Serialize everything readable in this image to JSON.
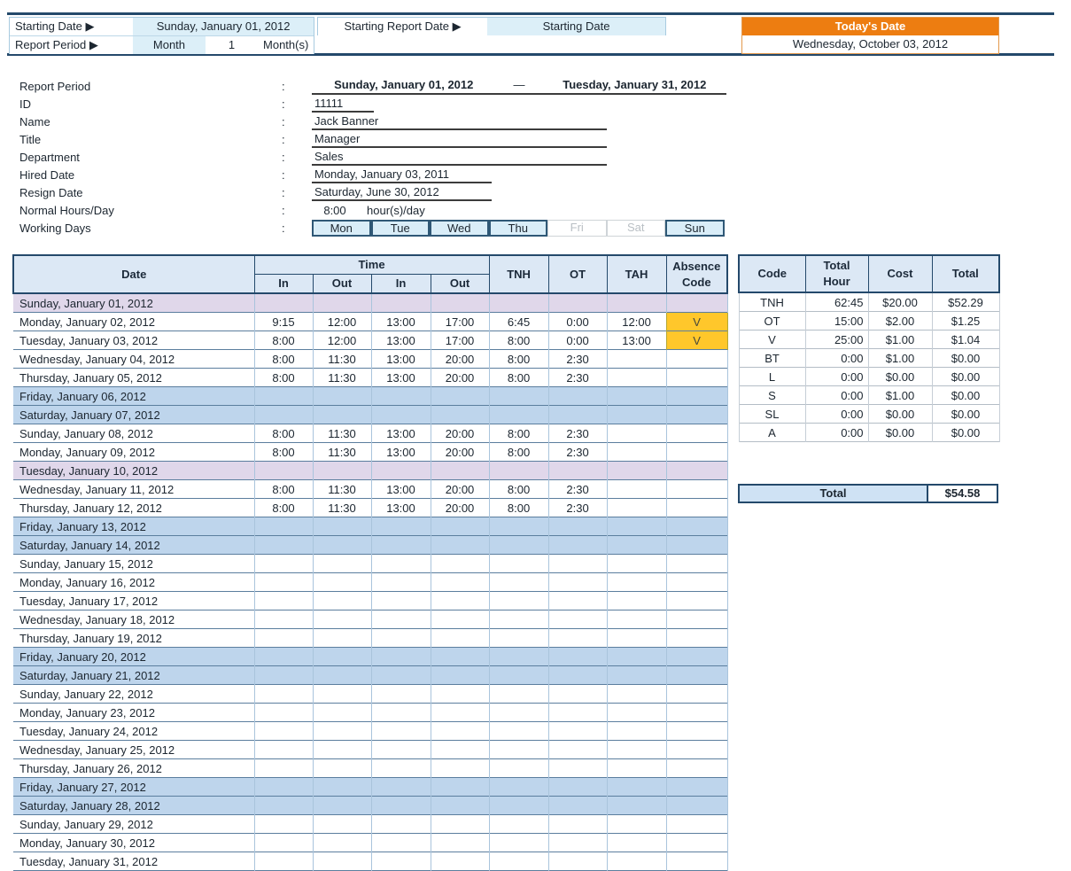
{
  "colors": {
    "navy": "#24496B",
    "orange": "#ED7D11",
    "header_blue": "#DCE8F5",
    "topbar_blue": "#DCEFF8",
    "weekend_blue": "#BED5EC",
    "holiday_purple": "#E0D7EA",
    "absence_gold": "#FFC72B"
  },
  "topbar": {
    "starting_date_label": "Starting Date ▶",
    "starting_date_value": "Sunday, January 01, 2012",
    "report_period_label": "Report Period ▶",
    "month_label": "Month",
    "month_value": "1",
    "months_label": "Month(s)",
    "starting_report_date_label": "Starting Report Date ▶",
    "starting_report_date_value": "Starting Date",
    "todays_date_label": "Today's Date",
    "todays_date_value": "Wednesday, October 03, 2012"
  },
  "info": {
    "colon": ":",
    "report_period": {
      "label": "Report Period",
      "from": "Sunday, January 01, 2012",
      "dash": "—",
      "to": "Tuesday, January 31, 2012"
    },
    "id": {
      "label": "ID",
      "value": "11111"
    },
    "name": {
      "label": "Name",
      "value": "Jack Banner"
    },
    "title": {
      "label": "Title",
      "value": "Manager"
    },
    "department": {
      "label": "Department",
      "value": "Sales"
    },
    "hired_date": {
      "label": "Hired Date",
      "value": "Monday, January 03, 2011"
    },
    "resign_date": {
      "label": "Resign Date",
      "value": "Saturday, June 30, 2012"
    },
    "normal_hours": {
      "label": "Normal Hours/Day",
      "value": "8:00",
      "suffix": "hour(s)/day"
    },
    "working_days_label": "Working Days",
    "working_days": [
      {
        "name": "Mon",
        "active": true
      },
      {
        "name": "Tue",
        "active": true
      },
      {
        "name": "Wed",
        "active": true
      },
      {
        "name": "Thu",
        "active": true
      },
      {
        "name": "Fri",
        "active": false
      },
      {
        "name": "Sat",
        "active": false
      },
      {
        "name": "Sun",
        "active": true
      }
    ]
  },
  "timesheet": {
    "header": {
      "date": "Date",
      "time": "Time",
      "in1": "In",
      "out1": "Out",
      "in2": "In",
      "out2": "Out",
      "tnh": "TNH",
      "ot": "OT",
      "tah": "TAH",
      "absence": "Absence\nCode"
    },
    "rows": [
      {
        "date": "Sunday, January 01, 2012",
        "type": "holiday",
        "cells": [
          "",
          "",
          "",
          "",
          "",
          "",
          ""
        ],
        "absence": ""
      },
      {
        "date": "Monday, January 02, 2012",
        "type": "normal",
        "cells": [
          "9:15",
          "12:00",
          "13:00",
          "17:00",
          "6:45",
          "0:00",
          "12:00"
        ],
        "absence": "V"
      },
      {
        "date": "Tuesday, January 03, 2012",
        "type": "normal",
        "cells": [
          "8:00",
          "12:00",
          "13:00",
          "17:00",
          "8:00",
          "0:00",
          "13:00"
        ],
        "absence": "V"
      },
      {
        "date": "Wednesday, January 04, 2012",
        "type": "normal",
        "cells": [
          "8:00",
          "11:30",
          "13:00",
          "20:00",
          "8:00",
          "2:30",
          ""
        ],
        "absence": ""
      },
      {
        "date": "Thursday, January 05, 2012",
        "type": "normal",
        "cells": [
          "8:00",
          "11:30",
          "13:00",
          "20:00",
          "8:00",
          "2:30",
          ""
        ],
        "absence": ""
      },
      {
        "date": "Friday, January 06, 2012",
        "type": "weekend",
        "cells": [
          "",
          "",
          "",
          "",
          "",
          "",
          ""
        ],
        "absence": ""
      },
      {
        "date": "Saturday, January 07, 2012",
        "type": "weekend",
        "cells": [
          "",
          "",
          "",
          "",
          "",
          "",
          ""
        ],
        "absence": ""
      },
      {
        "date": "Sunday, January 08, 2012",
        "type": "normal",
        "cells": [
          "8:00",
          "11:30",
          "13:00",
          "20:00",
          "8:00",
          "2:30",
          ""
        ],
        "absence": ""
      },
      {
        "date": "Monday, January 09, 2012",
        "type": "normal",
        "cells": [
          "8:00",
          "11:30",
          "13:00",
          "20:00",
          "8:00",
          "2:30",
          ""
        ],
        "absence": ""
      },
      {
        "date": "Tuesday, January 10, 2012",
        "type": "holiday",
        "cells": [
          "",
          "",
          "",
          "",
          "",
          "",
          ""
        ],
        "absence": ""
      },
      {
        "date": "Wednesday, January 11, 2012",
        "type": "normal",
        "cells": [
          "8:00",
          "11:30",
          "13:00",
          "20:00",
          "8:00",
          "2:30",
          ""
        ],
        "absence": ""
      },
      {
        "date": "Thursday, January 12, 2012",
        "type": "normal",
        "cells": [
          "8:00",
          "11:30",
          "13:00",
          "20:00",
          "8:00",
          "2:30",
          ""
        ],
        "absence": ""
      },
      {
        "date": "Friday, January 13, 2012",
        "type": "weekend",
        "cells": [
          "",
          "",
          "",
          "",
          "",
          "",
          ""
        ],
        "absence": ""
      },
      {
        "date": "Saturday, January 14, 2012",
        "type": "weekend",
        "cells": [
          "",
          "",
          "",
          "",
          "",
          "",
          ""
        ],
        "absence": ""
      },
      {
        "date": "Sunday, January 15, 2012",
        "type": "normal",
        "cells": [
          "",
          "",
          "",
          "",
          "",
          "",
          ""
        ],
        "absence": ""
      },
      {
        "date": "Monday, January 16, 2012",
        "type": "normal",
        "cells": [
          "",
          "",
          "",
          "",
          "",
          "",
          ""
        ],
        "absence": ""
      },
      {
        "date": "Tuesday, January 17, 2012",
        "type": "normal",
        "cells": [
          "",
          "",
          "",
          "",
          "",
          "",
          ""
        ],
        "absence": ""
      },
      {
        "date": "Wednesday, January 18, 2012",
        "type": "normal",
        "cells": [
          "",
          "",
          "",
          "",
          "",
          "",
          ""
        ],
        "absence": ""
      },
      {
        "date": "Thursday, January 19, 2012",
        "type": "normal",
        "cells": [
          "",
          "",
          "",
          "",
          "",
          "",
          ""
        ],
        "absence": ""
      },
      {
        "date": "Friday, January 20, 2012",
        "type": "weekend",
        "cells": [
          "",
          "",
          "",
          "",
          "",
          "",
          ""
        ],
        "absence": ""
      },
      {
        "date": "Saturday, January 21, 2012",
        "type": "weekend",
        "cells": [
          "",
          "",
          "",
          "",
          "",
          "",
          ""
        ],
        "absence": ""
      },
      {
        "date": "Sunday, January 22, 2012",
        "type": "normal",
        "cells": [
          "",
          "",
          "",
          "",
          "",
          "",
          ""
        ],
        "absence": ""
      },
      {
        "date": "Monday, January 23, 2012",
        "type": "normal",
        "cells": [
          "",
          "",
          "",
          "",
          "",
          "",
          ""
        ],
        "absence": ""
      },
      {
        "date": "Tuesday, January 24, 2012",
        "type": "normal",
        "cells": [
          "",
          "",
          "",
          "",
          "",
          "",
          ""
        ],
        "absence": ""
      },
      {
        "date": "Wednesday, January 25, 2012",
        "type": "normal",
        "cells": [
          "",
          "",
          "",
          "",
          "",
          "",
          ""
        ],
        "absence": ""
      },
      {
        "date": "Thursday, January 26, 2012",
        "type": "normal",
        "cells": [
          "",
          "",
          "",
          "",
          "",
          "",
          ""
        ],
        "absence": ""
      },
      {
        "date": "Friday, January 27, 2012",
        "type": "weekend",
        "cells": [
          "",
          "",
          "",
          "",
          "",
          "",
          ""
        ],
        "absence": ""
      },
      {
        "date": "Saturday, January 28, 2012",
        "type": "weekend",
        "cells": [
          "",
          "",
          "",
          "",
          "",
          "",
          ""
        ],
        "absence": ""
      },
      {
        "date": "Sunday, January 29, 2012",
        "type": "normal",
        "cells": [
          "",
          "",
          "",
          "",
          "",
          "",
          ""
        ],
        "absence": ""
      },
      {
        "date": "Monday, January 30, 2012",
        "type": "normal",
        "cells": [
          "",
          "",
          "",
          "",
          "",
          "",
          ""
        ],
        "absence": ""
      },
      {
        "date": "Tuesday, January 31, 2012",
        "type": "normal",
        "cells": [
          "",
          "",
          "",
          "",
          "",
          "",
          ""
        ],
        "absence": ""
      }
    ]
  },
  "summary": {
    "headers": [
      "Code",
      "Total\nHour",
      "Cost",
      "Total"
    ],
    "rows": [
      [
        "TNH",
        "62:45",
        "$20.00",
        "$52.29"
      ],
      [
        "OT",
        "15:00",
        "$2.00",
        "$1.25"
      ],
      [
        "V",
        "25:00",
        "$1.00",
        "$1.04"
      ],
      [
        "BT",
        "0:00",
        "$1.00",
        "$0.00"
      ],
      [
        "L",
        "0:00",
        "$0.00",
        "$0.00"
      ],
      [
        "S",
        "0:00",
        "$1.00",
        "$0.00"
      ],
      [
        "SL",
        "0:00",
        "$0.00",
        "$0.00"
      ],
      [
        "A",
        "0:00",
        "$0.00",
        "$0.00"
      ]
    ],
    "total_label": "Total",
    "total_value": "$54.58"
  }
}
